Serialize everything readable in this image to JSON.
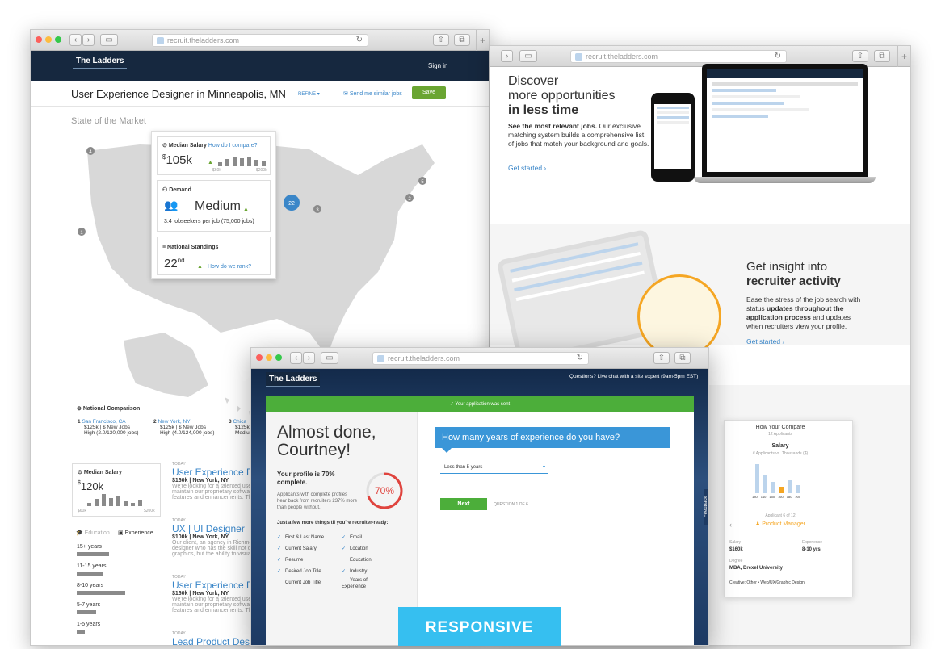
{
  "browser": {
    "url": "recruit.theladders.com"
  },
  "logo": {
    "text": "The Ladders"
  },
  "left": {
    "signin": "Sign in",
    "title": "User Experience Designer in Minneapolis, MN",
    "refine": "REFINE",
    "send_similar": "Send me similar jobs",
    "save": "Save",
    "state_market": "State of the Market",
    "map_numbers": [
      "4",
      "5",
      "22",
      "3",
      "2",
      "1"
    ],
    "median_salary": {
      "label": "Median Salary",
      "compare": "How do I compare?",
      "currency": "$",
      "value": "105k",
      "min": "$60k",
      "max": "$200k"
    },
    "demand": {
      "label": "Demand",
      "value": "Medium",
      "sub": "3.4 jobseekers per job (75,000 jobs)"
    },
    "standings": {
      "label": "National Standings",
      "value": "22",
      "suffix": "nd",
      "link": "How do we rank?"
    },
    "national": {
      "label": "National Comparison",
      "items": [
        {
          "rank": "1",
          "city": "San Francisco, CA",
          "salary": "$125k | $ New Jobs",
          "note": "High (2.0/130,000 jobs)"
        },
        {
          "rank": "2",
          "city": "New York, NY",
          "salary": "$125k | $ New Jobs",
          "note": "High (4.0/124,000 jobs)"
        },
        {
          "rank": "3",
          "city": "Chica",
          "salary": "$125k",
          "note": "Mediu"
        }
      ]
    },
    "side_salary": {
      "label": "Median Salary",
      "currency": "$",
      "value": "120k",
      "min": "$60k",
      "max": "$200k"
    },
    "tabs": {
      "education": "Education",
      "experience": "Experience"
    },
    "exp_levels": [
      "15+ years",
      "11-15 years",
      "8-10 years",
      "5-7 years",
      "1-5 years"
    ],
    "jobs": [
      {
        "day": "TODAY",
        "title": "User Experience De",
        "meta": "$160k | New York, NY",
        "desc": "We're looking for a talented use maintain our proprietary softwa features and enhancements. Th"
      },
      {
        "day": "TODAY",
        "title": "UX | UI Designer",
        "meta": "$100k | New York, NY",
        "desc": "Our client, an agency in Richmo designer who has the skill not o graphics, but the ability to visua"
      },
      {
        "day": "TODAY",
        "title": "User Experience De",
        "meta": "$160k | New York, NY",
        "desc": "We're looking for a talented use maintain our proprietary softwa features and enhancements. Th"
      },
      {
        "day": "TODAY",
        "title": "Lead Product Desig",
        "meta": "",
        "desc": ""
      }
    ]
  },
  "right": {
    "h1": "Discover",
    "h2": "more opportunities",
    "h3": "in less time",
    "desc_bold": "See the most relevant jobs.",
    "desc": " Our exclusive matching system builds a comprehensive list of jobs that match your background and goals.",
    "cta": "Get started ›",
    "i1": "Get insight into",
    "i2": "recruiter activity",
    "d2a": "Ease the stress of the job search with status ",
    "d2b": "updates throughout the application process",
    "d2c": " and updates when recruiters view your profile.",
    "cta2": "Get started ›",
    "mobile": {
      "title": "How Your Compare",
      "sub": "12 Applicants",
      "chart_title": "Salary",
      "chart_sub": "# Applicants vs. Thousands ($)",
      "ticks": [
        "130",
        "140",
        "150",
        "160",
        "180",
        "200"
      ],
      "applicant": "Applicant 6 of 12",
      "job": "Product Manager",
      "salary_label": "Salary",
      "salary": "$160k",
      "exp_label": "Experience",
      "exp": "8-10 yrs",
      "degree_label": "Degree",
      "degree": "MBA, Drexel University",
      "creative": "Creative: Other • Web/UX/Graphic Design"
    }
  },
  "front": {
    "live_chat": "Questions? Live chat with a site expert (9am-5pm EST)",
    "sent": "Your application was sent",
    "greeting1": "Almost done,",
    "greeting2": "Courtney!",
    "complete": "Your profile is 70% complete.",
    "complete_desc": "Applicants with complete profiles hear back from recruiters 237% more than people without.",
    "percent": "70%",
    "few": "Just a few more things til you're recruiter-ready:",
    "col1": [
      "First & Last Name",
      "Current Salary",
      "Resume",
      "Desired Job Title",
      "Current Job Title"
    ],
    "col1_check": [
      true,
      true,
      true,
      true,
      false
    ],
    "col2": [
      "Email",
      "Location",
      "Education",
      "Industry",
      "Years of Experience"
    ],
    "col2_check": [
      true,
      true,
      false,
      true,
      false
    ],
    "question": "How many years of experience do you have?",
    "select": "Less than 5 years",
    "next": "Next",
    "progress": "QUESTION 1 OF 6",
    "feedback": "Feedback",
    "responsive": "RESPONSIVE"
  }
}
